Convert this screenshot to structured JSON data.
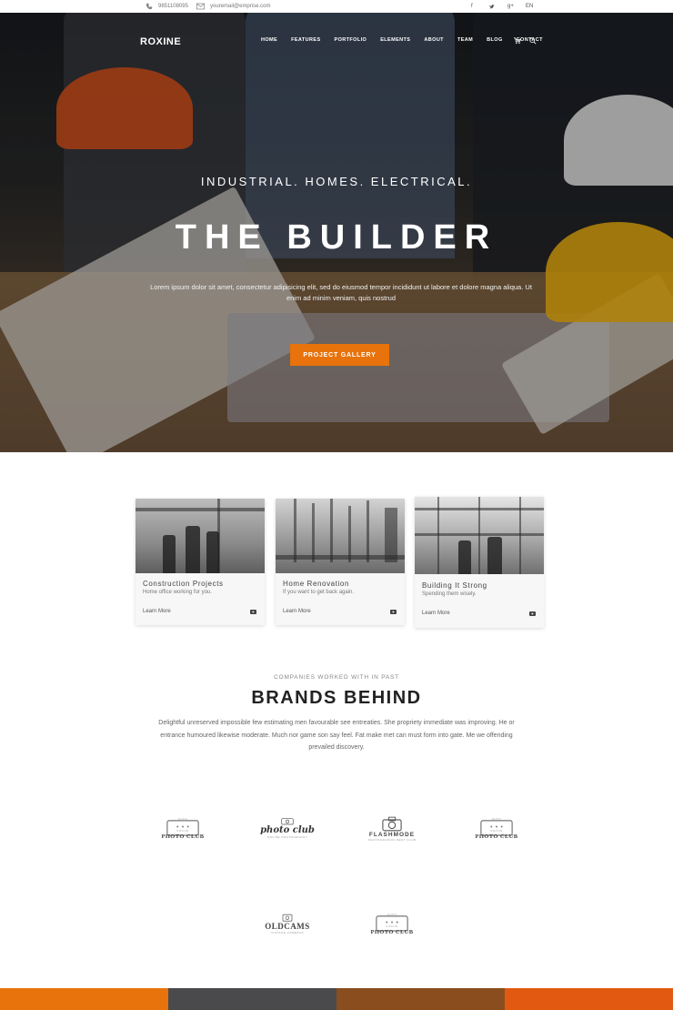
{
  "topbar": {
    "phone": "9851108095",
    "email": "youremail@emprise.com",
    "social_icons": [
      "facebook-icon",
      "twitter-icon",
      "google-plus-icon"
    ],
    "language": "EN"
  },
  "nav": {
    "logo": "ROXINE",
    "items": [
      "HOME",
      "FEATURES",
      "PORTFOLIO",
      "ELEMENTS",
      "ABOUT",
      "TEAM",
      "BLOG",
      "CONTACT"
    ],
    "icons": [
      "cart-icon",
      "search-icon"
    ]
  },
  "hero": {
    "subtitle": "INDUSTRIAL. HOMES. ELECTRICAL.",
    "title": "THE BUILDER",
    "text": "Lorem ipsum dolor sit amet, consectetur adipisicing elit, sed do eiusmod tempor incididunt ut labore et dolore magna aliqua. Ut enim ad minim veniam, quis nostrud",
    "button": "PROJECT GALLERY"
  },
  "cards": [
    {
      "title": "Construction Projects",
      "desc": "Home office working for you.",
      "link": "Learn More"
    },
    {
      "title": "Home Renovation",
      "desc": "If you want to get back again.",
      "link": "Learn More"
    },
    {
      "title": "Building It Strong",
      "desc": "Spending them wisely.",
      "link": "Learn More"
    }
  ],
  "brands": {
    "eyebrow": "COMPANIES WORKED WITH IN PAST",
    "title": "BRANDS BEHIND",
    "text": "Delightful unreserved impossible few estimating men favourable see entreaties. She propriety immediate was improving. He or entrance humoured likewise moderate. Much nor game son say feel. Fat make met can must form into gate. Me we offending prevailed discovery.",
    "logos": [
      {
        "name": "PHOTO CLUB",
        "top": "AUTO",
        "mid": "FOCUS"
      },
      {
        "name": "photo club",
        "tag": "ONLINE PHOTOGRAPHY"
      },
      {
        "name": "FLASHMODE",
        "tag": "PHOTOGRAPHIC BEST CLUB"
      },
      {
        "name": "PHOTO CLUB",
        "top": "AUTO",
        "mid": "FOCUS"
      },
      {
        "name": "OLDCAMS",
        "tag": "VINTAGE CAMERAS"
      },
      {
        "name": "PHOTO CLUB",
        "top": "AUTO",
        "mid": "FOCUS"
      }
    ]
  },
  "colors": {
    "accent": "#e8730c",
    "footer": [
      "#e8730c",
      "#4a4a4c",
      "#8a4e1e",
      "#e25a12"
    ]
  }
}
